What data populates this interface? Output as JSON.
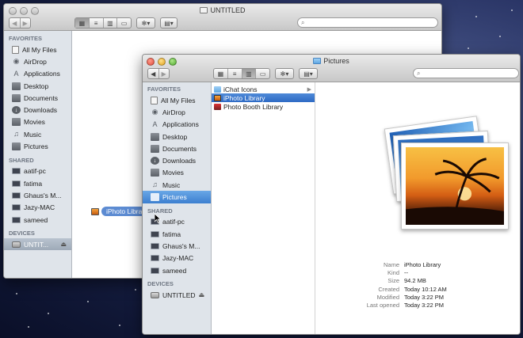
{
  "back_window": {
    "title": "UNTITLED",
    "search_placeholder": "",
    "favorites_header": "FAVORITES",
    "favorites": [
      "All My Files",
      "AirDrop",
      "Applications",
      "Desktop",
      "Documents",
      "Downloads",
      "Movies",
      "Music",
      "Pictures"
    ],
    "shared_header": "SHARED",
    "shared": [
      "aatif-pc",
      "fatima",
      "Ghaus's M...",
      "Jazy-MAC",
      "sameed"
    ],
    "devices_header": "DEVICES",
    "devices": [
      "UNTIT..."
    ]
  },
  "front_window": {
    "title": "Pictures",
    "search_placeholder": "",
    "favorites_header": "FAVORITES",
    "favorites": [
      "All My Files",
      "AirDrop",
      "Applications",
      "Desktop",
      "Documents",
      "Downloads",
      "Movies",
      "Music",
      "Pictures"
    ],
    "shared_header": "SHARED",
    "shared": [
      "aatif-pc",
      "fatima",
      "Ghaus's M...",
      "Jazy-MAC",
      "sameed"
    ],
    "devices_header": "DEVICES",
    "devices": [
      "UNTITLED"
    ],
    "column_items": [
      "iChat Icons",
      "iPhoto Library",
      "Photo Booth Library"
    ],
    "selected_item": "iPhoto Library",
    "info": [
      {
        "key": "Name",
        "value": "iPhoto Library"
      },
      {
        "key": "Kind",
        "value": "--"
      },
      {
        "key": "Size",
        "value": "94.2 MB"
      },
      {
        "key": "Created",
        "value": "Today 10:12 AM"
      },
      {
        "key": "Modified",
        "value": "Today 3:22 PM"
      },
      {
        "key": "Last opened",
        "value": "Today 3:22 PM"
      }
    ]
  },
  "drag_item": {
    "label": "iPhoto Library"
  },
  "icons": {
    "back": "back-arrow-icon",
    "forward": "forward-arrow-icon",
    "view_icons": "icon-view-icon",
    "view_list": "list-view-icon",
    "view_columns": "column-view-icon",
    "view_coverflow": "coverflow-view-icon",
    "action": "gear-icon",
    "arrange": "arrange-icon",
    "search": "search-icon",
    "eject": "eject-icon"
  },
  "colors": {
    "selection": "#3c7fd0",
    "sidebar_bg": "#dfe4ea",
    "desktop": "#1b2450"
  }
}
